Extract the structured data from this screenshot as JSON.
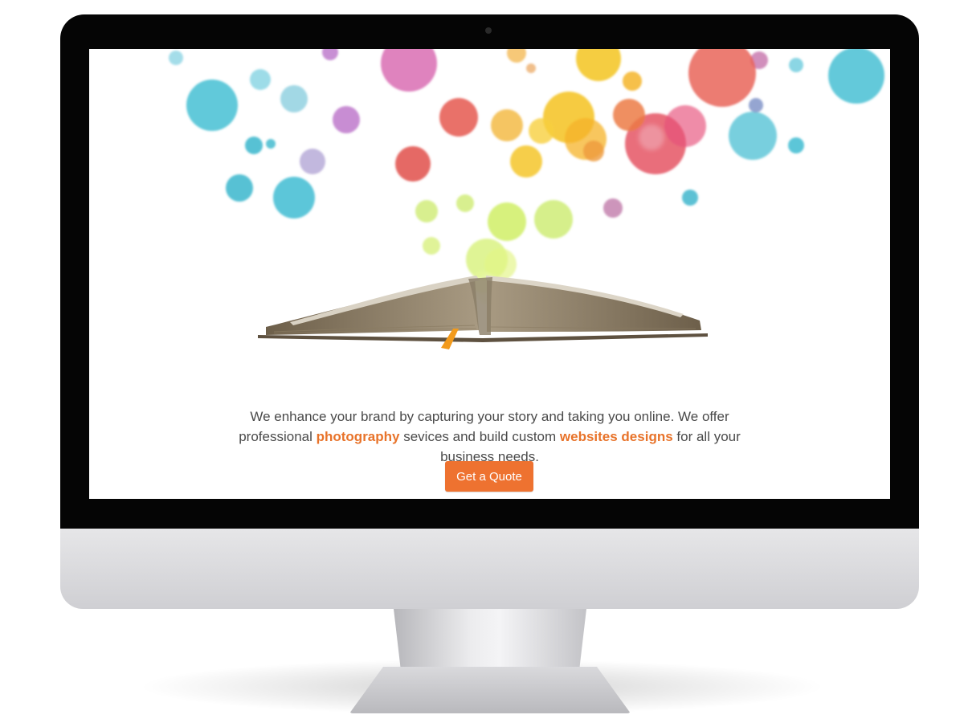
{
  "hero": {
    "text_part1": "We enhance your brand by capturing your story and taking you online. We offer professional ",
    "highlight1": "photography",
    "text_part2": " sevices and build custom ",
    "highlight2": "websites designs",
    "text_part3": " for all your business needs."
  },
  "cta": {
    "label": "Get a Quote"
  },
  "colors": {
    "accent": "#ee7230",
    "highlight_text": "#e8732a",
    "body_text": "#4a4a4a",
    "bezel": "#050505",
    "chin": "#d8d8db"
  },
  "icons": {
    "camera": "camera-dot-icon",
    "book": "open-book-illustration",
    "bubbles": "bokeh-bubbles-decoration"
  }
}
